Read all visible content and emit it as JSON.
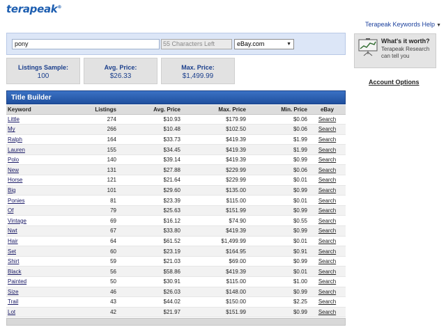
{
  "app": {
    "logo_text": "terapeak",
    "logo_mark": "®",
    "help_link": "Terapeak Keywords Help"
  },
  "search": {
    "keyword_value": "pony",
    "chars_left": "55 Characters Left",
    "site_selected": "eBay.com"
  },
  "stats": {
    "sample_label": "Listings Sample:",
    "sample_value": "100",
    "avg_label": "Avg. Price:",
    "avg_value": "$26.33",
    "max_label": "Max. Price:",
    "max_value": "$1,499.99"
  },
  "promo": {
    "title": "What's it worth?",
    "subtitle": "Terapeak Research can tell you"
  },
  "account_options": "Account Options",
  "title_builder": {
    "heading": "Title Builder",
    "columns": [
      "Keyword",
      "Listings",
      "Avg. Price",
      "Max. Price",
      "Min. Price",
      "eBay"
    ],
    "rows": [
      {
        "keyword": "Little",
        "listings": "274",
        "avg": "$10.93",
        "max": "$179.99",
        "min": "$0.06",
        "action": "Search"
      },
      {
        "keyword": "My",
        "listings": "266",
        "avg": "$10.48",
        "max": "$102.50",
        "min": "$0.06",
        "action": "Search"
      },
      {
        "keyword": "Ralph",
        "listings": "164",
        "avg": "$33.73",
        "max": "$419.39",
        "min": "$1.99",
        "action": "Search"
      },
      {
        "keyword": "Lauren",
        "listings": "155",
        "avg": "$34.45",
        "max": "$419.39",
        "min": "$1.99",
        "action": "Search"
      },
      {
        "keyword": "Polo",
        "listings": "140",
        "avg": "$39.14",
        "max": "$419.39",
        "min": "$0.99",
        "action": "Search"
      },
      {
        "keyword": "New",
        "listings": "131",
        "avg": "$27.88",
        "max": "$229.99",
        "min": "$0.06",
        "action": "Search"
      },
      {
        "keyword": "Horse",
        "listings": "121",
        "avg": "$21.64",
        "max": "$229.99",
        "min": "$0.01",
        "action": "Search"
      },
      {
        "keyword": "Big",
        "listings": "101",
        "avg": "$29.60",
        "max": "$135.00",
        "min": "$0.99",
        "action": "Search"
      },
      {
        "keyword": "Ponies",
        "listings": "81",
        "avg": "$23.39",
        "max": "$115.00",
        "min": "$0.01",
        "action": "Search"
      },
      {
        "keyword": "Of",
        "listings": "79",
        "avg": "$25.63",
        "max": "$151.99",
        "min": "$0.99",
        "action": "Search"
      },
      {
        "keyword": "Vintage",
        "listings": "69",
        "avg": "$16.12",
        "max": "$74.90",
        "min": "$0.55",
        "action": "Search"
      },
      {
        "keyword": "Nwt",
        "listings": "67",
        "avg": "$33.80",
        "max": "$419.39",
        "min": "$0.99",
        "action": "Search"
      },
      {
        "keyword": "Hair",
        "listings": "64",
        "avg": "$61.52",
        "max": "$1,499.99",
        "min": "$0.01",
        "action": "Search"
      },
      {
        "keyword": "Set",
        "listings": "60",
        "avg": "$23.19",
        "max": "$164.95",
        "min": "$0.91",
        "action": "Search"
      },
      {
        "keyword": "Shirt",
        "listings": "59",
        "avg": "$21.03",
        "max": "$69.00",
        "min": "$0.99",
        "action": "Search"
      },
      {
        "keyword": "Black",
        "listings": "56",
        "avg": "$58.86",
        "max": "$419.39",
        "min": "$0.01",
        "action": "Search"
      },
      {
        "keyword": "Painted",
        "listings": "50",
        "avg": "$30.91",
        "max": "$115.00",
        "min": "$1.00",
        "action": "Search"
      },
      {
        "keyword": "Size",
        "listings": "46",
        "avg": "$26.03",
        "max": "$148.00",
        "min": "$0.99",
        "action": "Search"
      },
      {
        "keyword": "Trail",
        "listings": "43",
        "avg": "$44.02",
        "max": "$150.00",
        "min": "$2.25",
        "action": "Search"
      },
      {
        "keyword": "Lot",
        "listings": "42",
        "avg": "$21.97",
        "max": "$151.99",
        "min": "$0.99",
        "action": "Search"
      }
    ]
  },
  "icons": {
    "caret": "chevron-down-icon",
    "promo": "chart-presentation-icon"
  },
  "colors": {
    "brand_blue": "#1d5eb0",
    "header_blue": "#2a5fb0",
    "panel_bg": "#dce6f7",
    "stat_bg": "#e2e2e2"
  }
}
